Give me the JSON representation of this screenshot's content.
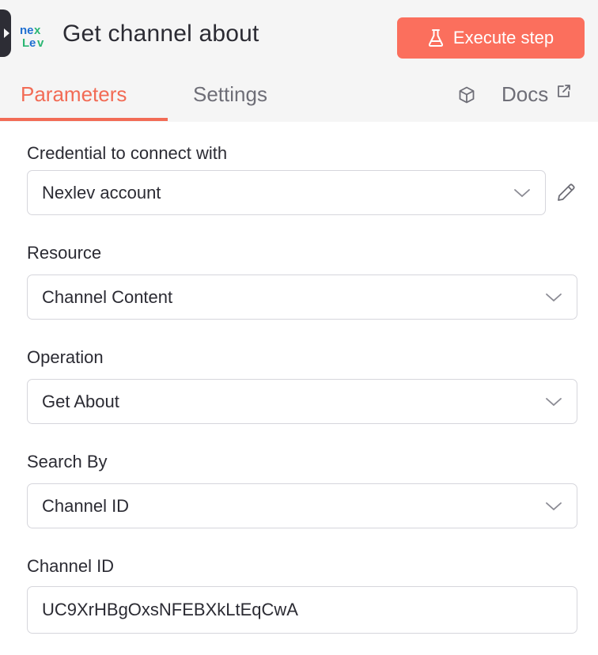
{
  "header": {
    "title": "Get channel about",
    "execute_label": "Execute step",
    "accent_color": "#fb6f5d"
  },
  "tabs": [
    {
      "label": "Parameters",
      "active": true
    },
    {
      "label": "Settings",
      "active": false
    }
  ],
  "docs_label": "Docs",
  "fields": {
    "credential": {
      "label": "Credential to connect with",
      "value": "Nexlev account"
    },
    "resource": {
      "label": "Resource",
      "value": "Channel Content"
    },
    "operation": {
      "label": "Operation",
      "value": "Get About"
    },
    "search_by": {
      "label": "Search By",
      "value": "Channel ID"
    },
    "channel_id": {
      "label": "Channel ID",
      "value": "UC9XrHBgOxsNFEBXkLtEqCwA"
    }
  },
  "icons": {
    "node_logo": "nexlev-logo-icon",
    "execute": "flask-icon",
    "cube": "cube-icon",
    "docs": "external-link-icon",
    "edit": "pencil-icon",
    "dropdown": "chevron-down-icon"
  }
}
